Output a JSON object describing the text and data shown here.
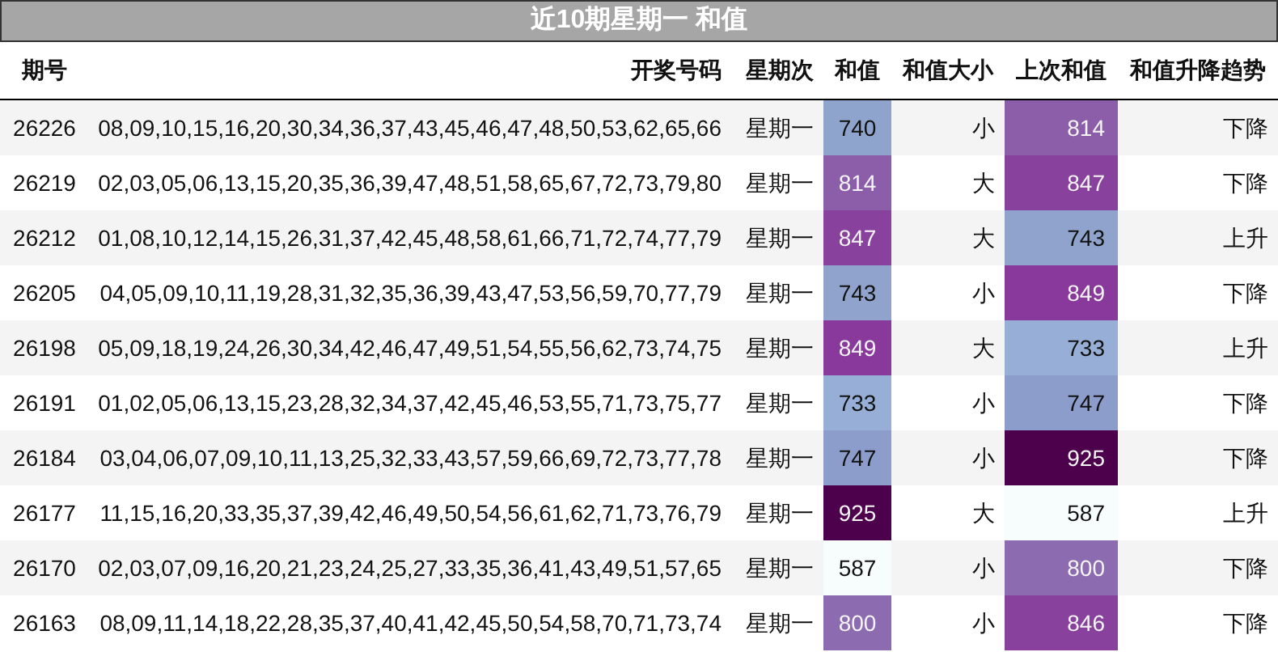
{
  "title": "近10期星期一 和值",
  "columns": [
    "期号",
    "开奖号码",
    "星期次",
    "和值",
    "和值大小",
    "上次和值",
    "和值升降趋势"
  ],
  "rows": [
    {
      "issue": "26226",
      "numbers": "08,09,10,15,16,20,30,34,36,37,43,45,46,47,48,50,53,62,65,66",
      "weekday": "星期一",
      "sum": {
        "value": "740",
        "color": "#8fa4cd"
      },
      "size": "小",
      "prev_sum": {
        "value": "814",
        "color": "#8c5eaa"
      },
      "trend": "下降"
    },
    {
      "issue": "26219",
      "numbers": "02,03,05,06,13,15,20,35,36,39,47,48,51,58,65,67,72,73,79,80",
      "weekday": "星期一",
      "sum": {
        "value": "814",
        "color": "#8c5eaa"
      },
      "size": "大",
      "prev_sum": {
        "value": "847",
        "color": "#88419d"
      },
      "trend": "下降"
    },
    {
      "issue": "26212",
      "numbers": "01,08,10,12,14,15,26,31,37,42,45,48,58,61,66,71,72,74,77,79",
      "weekday": "星期一",
      "sum": {
        "value": "847",
        "color": "#88419d"
      },
      "size": "大",
      "prev_sum": {
        "value": "743",
        "color": "#8fa3cc"
      },
      "trend": "上升"
    },
    {
      "issue": "26205",
      "numbers": "04,05,09,10,11,19,28,31,32,35,36,39,43,47,53,56,59,70,77,79",
      "weekday": "星期一",
      "sum": {
        "value": "743",
        "color": "#8fa3cc"
      },
      "size": "小",
      "prev_sum": {
        "value": "849",
        "color": "#88399b"
      },
      "trend": "下降"
    },
    {
      "issue": "26198",
      "numbers": "05,09,18,19,24,26,30,34,42,46,47,49,51,54,55,56,62,73,74,75",
      "weekday": "星期一",
      "sum": {
        "value": "849",
        "color": "#88399b"
      },
      "size": "大",
      "prev_sum": {
        "value": "733",
        "color": "#97afd6"
      },
      "trend": "上升"
    },
    {
      "issue": "26191",
      "numbers": "01,02,05,06,13,15,23,28,32,34,37,42,45,46,53,55,71,73,75,77",
      "weekday": "星期一",
      "sum": {
        "value": "733",
        "color": "#97afd6"
      },
      "size": "小",
      "prev_sum": {
        "value": "747",
        "color": "#8c9ccb"
      },
      "trend": "下降"
    },
    {
      "issue": "26184",
      "numbers": "03,04,06,07,09,10,11,13,25,32,33,43,57,59,66,69,72,73,77,78",
      "weekday": "星期一",
      "sum": {
        "value": "747",
        "color": "#8c9ccb"
      },
      "size": "小",
      "prev_sum": {
        "value": "925",
        "color": "#4d004b"
      },
      "trend": "下降"
    },
    {
      "issue": "26177",
      "numbers": "11,15,16,20,33,35,37,39,42,46,49,50,54,56,61,62,71,73,76,79",
      "weekday": "星期一",
      "sum": {
        "value": "925",
        "color": "#4d004b"
      },
      "size": "大",
      "prev_sum": {
        "value": "587",
        "color": "#f7fcfd"
      },
      "trend": "上升"
    },
    {
      "issue": "26170",
      "numbers": "02,03,07,09,16,20,21,23,24,25,27,33,35,36,41,43,49,51,57,65",
      "weekday": "星期一",
      "sum": {
        "value": "587",
        "color": "#f7fcfd"
      },
      "size": "小",
      "prev_sum": {
        "value": "800",
        "color": "#8c6bb1"
      },
      "trend": "下降"
    },
    {
      "issue": "26163",
      "numbers": "08,09,11,14,18,22,28,35,37,40,41,42,45,50,54,58,70,71,73,74",
      "weekday": "星期一",
      "sum": {
        "value": "800",
        "color": "#8c6bb1"
      },
      "size": "小",
      "prev_sum": {
        "value": "846",
        "color": "#88419d"
      },
      "trend": "下降"
    }
  ]
}
